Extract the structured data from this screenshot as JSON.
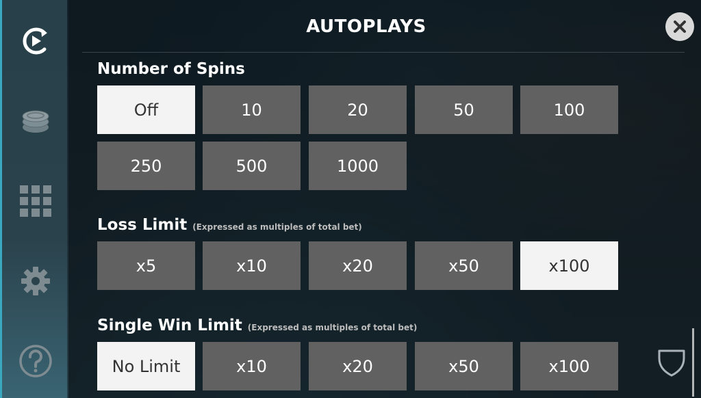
{
  "header": {
    "title": "AUTOPLAYS"
  },
  "sidebar": {
    "items": [
      {
        "icon": "autoplay-icon"
      },
      {
        "icon": "coins-icon"
      },
      {
        "icon": "grid-icon"
      },
      {
        "icon": "gear-icon"
      },
      {
        "icon": "help-icon"
      }
    ]
  },
  "spins": {
    "label": "Number of Spins",
    "options": [
      "Off",
      "10",
      "20",
      "50",
      "100",
      "250",
      "500",
      "1000"
    ],
    "selected": "Off"
  },
  "loss_limit": {
    "label": "Loss Limit",
    "note": "(Expressed as multiples of total bet)",
    "options": [
      "x5",
      "x10",
      "x20",
      "x50",
      "x100"
    ],
    "selected": "x100"
  },
  "win_limit": {
    "label": "Single Win Limit",
    "note": "(Expressed as multiples of total bet)",
    "options": [
      "No Limit",
      "x10",
      "x20",
      "x50",
      "x100"
    ],
    "selected": "No Limit"
  },
  "colors": {
    "accent": "#3aa8bf",
    "option_bg": "#616161",
    "option_selected_bg": "#f3f3f3",
    "text": "#ffffff"
  }
}
